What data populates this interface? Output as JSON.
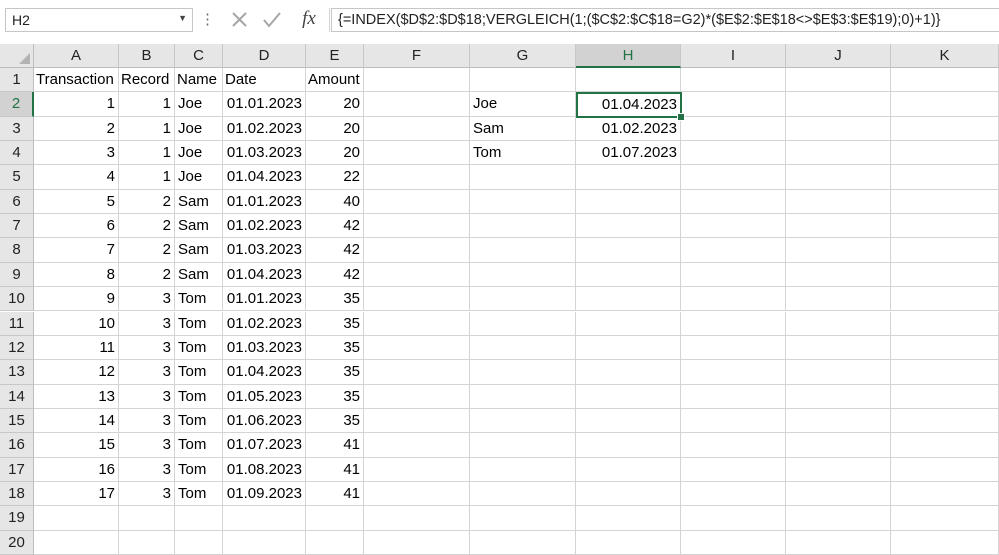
{
  "formula_bar": {
    "name_box": "H2",
    "name_box_dropdown_icon": "chevron-down-icon",
    "separator_icon": "vertical-dots-icon",
    "cancel_icon": "close-icon",
    "enter_icon": "checkmark-icon",
    "fx_label": "fx",
    "formula": "{=INDEX($D$2:$D$18;VERGLEICH(1;($C$2:$C$18=G2)*($E$2:$E$18<>$E$3:$E$19);0)+1)}"
  },
  "columns": [
    "A",
    "B",
    "C",
    "D",
    "E",
    "F",
    "G",
    "H",
    "I",
    "J",
    "K"
  ],
  "active_column": "H",
  "rows": [
    "1",
    "2",
    "3",
    "4",
    "5",
    "6",
    "7",
    "8",
    "9",
    "10",
    "11",
    "12",
    "13",
    "14",
    "15",
    "16",
    "17",
    "18",
    "19",
    "20"
  ],
  "active_row": "2",
  "table": {
    "headers": [
      "Transaction",
      "Record",
      "Name",
      "Date",
      "Amount"
    ],
    "records": [
      [
        "1",
        "1",
        "Joe",
        "01.01.2023",
        "20"
      ],
      [
        "2",
        "1",
        "Joe",
        "01.02.2023",
        "20"
      ],
      [
        "3",
        "1",
        "Joe",
        "01.03.2023",
        "20"
      ],
      [
        "4",
        "1",
        "Joe",
        "01.04.2023",
        "22"
      ],
      [
        "5",
        "2",
        "Sam",
        "01.01.2023",
        "40"
      ],
      [
        "6",
        "2",
        "Sam",
        "01.02.2023",
        "42"
      ],
      [
        "7",
        "2",
        "Sam",
        "01.03.2023",
        "42"
      ],
      [
        "8",
        "2",
        "Sam",
        "01.04.2023",
        "42"
      ],
      [
        "9",
        "3",
        "Tom",
        "01.01.2023",
        "35"
      ],
      [
        "10",
        "3",
        "Tom",
        "01.02.2023",
        "35"
      ],
      [
        "11",
        "3",
        "Tom",
        "01.03.2023",
        "35"
      ],
      [
        "12",
        "3",
        "Tom",
        "01.04.2023",
        "35"
      ],
      [
        "13",
        "3",
        "Tom",
        "01.05.2023",
        "35"
      ],
      [
        "14",
        "3",
        "Tom",
        "01.06.2023",
        "35"
      ],
      [
        "15",
        "3",
        "Tom",
        "01.07.2023",
        "41"
      ],
      [
        "16",
        "3",
        "Tom",
        "01.08.2023",
        "41"
      ],
      [
        "17",
        "3",
        "Tom",
        "01.09.2023",
        "41"
      ]
    ]
  },
  "results": [
    {
      "name": "Joe",
      "date": "01.04.2023"
    },
    {
      "name": "Sam",
      "date": "01.02.2023"
    },
    {
      "name": "Tom",
      "date": "01.07.2023"
    }
  ],
  "colors": {
    "selection": "#217346",
    "header_bg": "#e6e6e6",
    "gridline": "#d4d4d4"
  }
}
